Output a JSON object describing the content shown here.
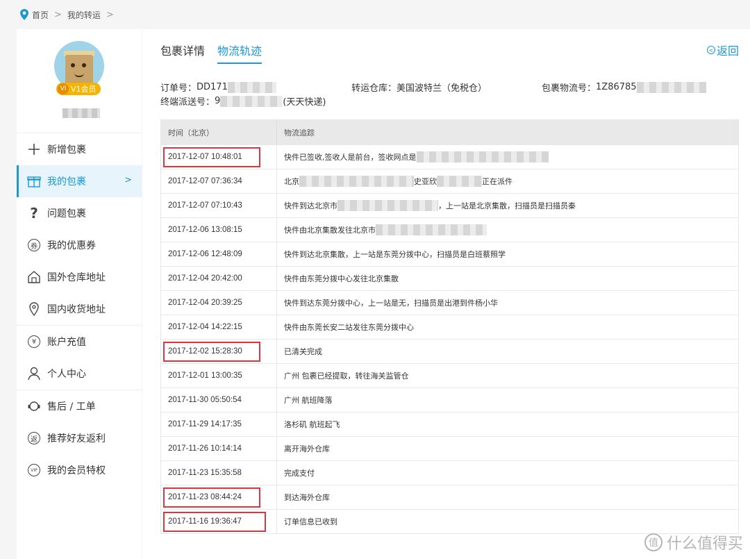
{
  "breadcrumb": {
    "home": "首页",
    "current": "我的转运"
  },
  "profile": {
    "vip_icon": "VI",
    "vip_label": "V1会员"
  },
  "sidebar": {
    "items": [
      {
        "label": "新增包裹",
        "icon": "plus-icon"
      },
      {
        "label": "我的包裹",
        "icon": "gift-box-icon",
        "active": true
      },
      {
        "label": "问题包裹",
        "icon": "question-icon"
      },
      {
        "label": "我的优惠券",
        "icon": "coupon-icon",
        "glyph": "券"
      },
      {
        "label": "国外仓库地址",
        "icon": "warehouse-icon"
      },
      {
        "label": "国内收货地址",
        "icon": "location-pin-icon"
      },
      {
        "label": "账户充值",
        "icon": "yuan-icon",
        "glyph": "¥"
      },
      {
        "label": "个人中心",
        "icon": "user-icon"
      },
      {
        "label": "售后 / 工单",
        "icon": "headset-icon"
      },
      {
        "label": "推荐好友返利",
        "icon": "rebate-icon",
        "glyph": "返"
      },
      {
        "label": "我的会员特权",
        "icon": "vip-privilege-icon",
        "glyph": "VIP"
      }
    ]
  },
  "tabs": [
    {
      "label": "包裹详情",
      "active": false
    },
    {
      "label": "物流轨迹",
      "active": true
    }
  ],
  "back_label": "返回",
  "info": {
    "order_label": "订单号：",
    "order_value": "DD171",
    "warehouse_label": "转运仓库：",
    "warehouse_value": "美国波特兰（免税仓）",
    "tracking_label": "包裹物流号：",
    "tracking_value": "1Z86785",
    "delivery_label": "终端派送号：",
    "delivery_value_prefix": "9",
    "delivery_value_suffix": "(天天快递)"
  },
  "table": {
    "headers": {
      "time": "时间（北京）",
      "track": "物流追踪"
    },
    "rows": [
      {
        "time": "2017-12-07 10:48:01",
        "text": "快件已签收,签收人是前台，签收网点是",
        "highlight": true
      },
      {
        "time": "2017-12-07 07:36:34",
        "text": "北京",
        "text2": "史亚欣",
        "text3": "正在派件"
      },
      {
        "time": "2017-12-07 07:10:43",
        "text": "快件到达北京市",
        "text2": "，上一站是北京集散，扫描员是扫描员秦"
      },
      {
        "time": "2017-12-06 13:08:15",
        "text": "快件由北京集散发往北京市"
      },
      {
        "time": "2017-12-06 12:48:09",
        "text": "快件到达北京集散，上一站是东莞分拨中心，扫描员是白班蔡照学"
      },
      {
        "time": "2017-12-04 20:42:00",
        "text": "快件由东莞分拨中心发往北京集散"
      },
      {
        "time": "2017-12-04 20:39:25",
        "text": "快件到达东莞分拨中心，上一站是无，扫描员是出港到件杨小华"
      },
      {
        "time": "2017-12-04 14:22:15",
        "text": "快件由东莞长安二站发往东莞分拨中心"
      },
      {
        "time": "2017-12-02 15:28:30",
        "text": "已清关完成",
        "highlight": true
      },
      {
        "time": "2017-12-01 13:00:35",
        "text": "广州 包裹已经提取，转往海关监管仓"
      },
      {
        "time": "2017-11-30 05:50:54",
        "text": "广州 航班降落"
      },
      {
        "time": "2017-11-29 14:17:35",
        "text": "洛杉矶 航班起飞"
      },
      {
        "time": "2017-11-26 10:14:14",
        "text": "离开海外仓库"
      },
      {
        "time": "2017-11-23 15:35:58",
        "text": "完成支付"
      },
      {
        "time": "2017-11-23 08:44:24",
        "text": "到达海外仓库",
        "highlight": true
      },
      {
        "time": "2017-11-16 19:36:47",
        "text": "订单信息已收到",
        "highlight": true
      }
    ]
  },
  "watermark": {
    "icon": "值",
    "text": "什么值得买"
  },
  "colors": {
    "accent": "#1a97d5",
    "highlight_border": "#d9363e"
  }
}
